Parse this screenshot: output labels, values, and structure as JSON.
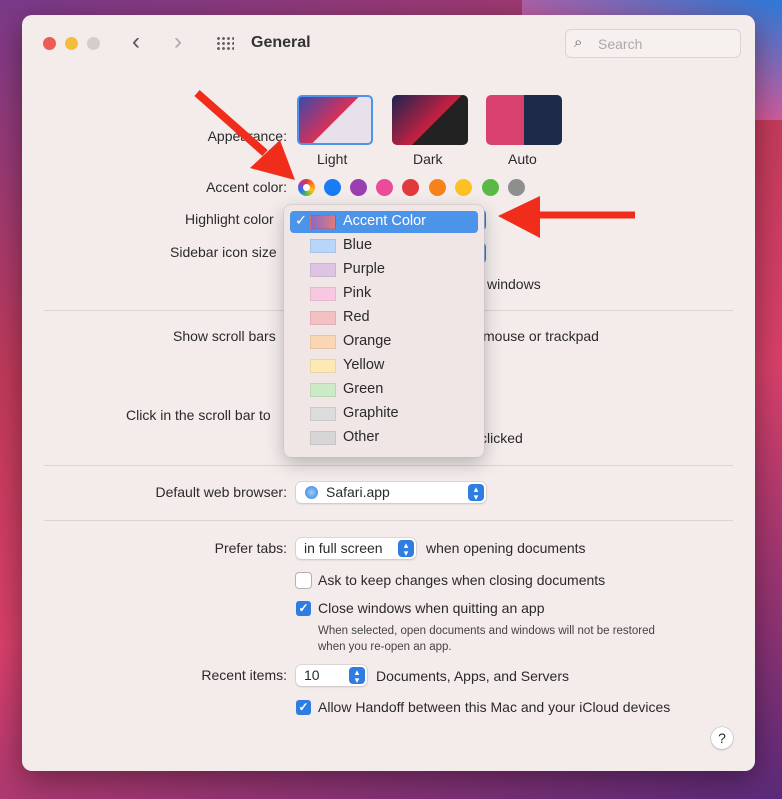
{
  "window": {
    "title": "General",
    "search_placeholder": "Search"
  },
  "appearance": {
    "label": "Appearance:",
    "options": [
      "Light",
      "Dark",
      "Auto"
    ],
    "selected": "Light"
  },
  "accent": {
    "label": "Accent color:",
    "colors": [
      "multicolor",
      "#1a7cf5",
      "#9a3fb0",
      "#ea4c9a",
      "#e0393e",
      "#f7821b",
      "#fcc224",
      "#5ab946",
      "#8e8e8e"
    ],
    "selected": 0
  },
  "highlight": {
    "label": "Highlight color"
  },
  "sidebar": {
    "label": "Sidebar icon size",
    "windows_fragment": "windows"
  },
  "scroll": {
    "show_label": "Show scroll bars",
    "show_fragment": "mouse or trackpad",
    "click_label": "Click in the scroll bar to",
    "click_fragment": "clicked"
  },
  "browser": {
    "label": "Default web browser:",
    "value": "Safari.app"
  },
  "tabs": {
    "label": "Prefer tabs:",
    "value": "in full screen",
    "suffix": "when opening documents"
  },
  "checkboxes": [
    {
      "label": "Ask to keep changes when closing documents",
      "checked": false
    },
    {
      "label": "Close windows when quitting an app",
      "checked": true
    }
  ],
  "note": [
    "When selected, open documents and windows will not be restored",
    "when you re-open an app."
  ],
  "recent": {
    "label": "Recent items:",
    "value": "10",
    "suffix": "Documents, Apps, and Servers"
  },
  "handoff": {
    "label": "Allow Handoff between this Mac and your iCloud devices",
    "checked": true
  },
  "help": "?",
  "menu": {
    "checkmark": "✓",
    "items": [
      {
        "label": "Accent Color",
        "swatch": "linear-gradient(90deg,#8a6ac8,#e07a7a)",
        "selected": true
      },
      {
        "label": "Blue",
        "swatch": "#b8d6fa"
      },
      {
        "label": "Purple",
        "swatch": "#dcc4e2"
      },
      {
        "label": "Pink",
        "swatch": "#f8c8e0"
      },
      {
        "label": "Red",
        "swatch": "#f4c0c4"
      },
      {
        "label": "Orange",
        "swatch": "#fbd6b4"
      },
      {
        "label": "Yellow",
        "swatch": "#fce9b4"
      },
      {
        "label": "Green",
        "swatch": "#cdeac6"
      },
      {
        "label": "Graphite",
        "swatch": "#dcdcdc"
      },
      {
        "label": "Other",
        "swatch": "#d6d6d6"
      }
    ]
  },
  "annotation_color": "#f02d1a"
}
